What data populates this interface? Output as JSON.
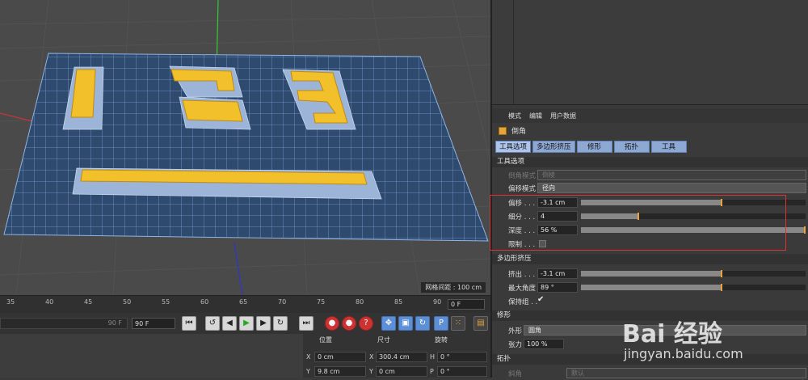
{
  "viewport": {
    "grid_spacing_label": "网格间距 : 100 cm"
  },
  "timeline": {
    "ticks": [
      "35",
      "40",
      "45",
      "50",
      "55",
      "60",
      "65",
      "70",
      "75",
      "80",
      "85",
      "90"
    ],
    "end_frame": "0 F"
  },
  "transport": {
    "slider_value": "90 F",
    "frame_field": "90 F"
  },
  "coordinates": {
    "headers": {
      "position": "位置",
      "size": "尺寸",
      "rotation": "旋转"
    },
    "rows": [
      {
        "axis": "X",
        "pos": "0 cm",
        "size_axis": "X",
        "size": "300.4 cm",
        "rot_axis": "H",
        "rot": "0 °"
      },
      {
        "axis": "Y",
        "pos": "9.8 cm",
        "size_axis": "Y",
        "size": "0 cm",
        "rot_axis": "P",
        "rot": "0 °"
      }
    ]
  },
  "panel": {
    "menu": [
      "模式",
      "编辑",
      "用户数据"
    ],
    "object_name": "倒角",
    "tabs": [
      "工具选项",
      "多边形挤压",
      "修形",
      "拓扑",
      "工具"
    ],
    "tool_options": {
      "section": "工具选项",
      "bevel_mode_label": "倒角模式",
      "bevel_mode_value": "倒棱",
      "offset_mode_label": "偏移模式",
      "offset_mode_value": "径向",
      "offset_label": "偏移 . . .",
      "offset_value": "-3.1 cm",
      "offset_fraction": 0.63,
      "subdiv_label": "细分 . . .",
      "subdiv_value": "4",
      "subdiv_fraction": 0.26,
      "depth_label": "深度 . . .",
      "depth_value": "56 %",
      "depth_fraction": 1.0,
      "limit_label": "限制 . . ."
    },
    "extrude": {
      "section": "多边形挤压",
      "extrude_label": "挤出 . . .",
      "extrude_value": "-3.1 cm",
      "extrude_fraction": 0.63,
      "max_angle_label": "最大角度",
      "max_angle_value": "89 °",
      "max_angle_fraction": 0.63,
      "keep_groups_label": "保持组 . ."
    },
    "shaping": {
      "section": "修形",
      "shape_label": "外形",
      "shape_value": "圆角",
      "tension_label": "张力",
      "tension_value": "100 %"
    },
    "topology": {
      "section": "拓扑",
      "mitering_label": "斜角",
      "mitering_value": "默认"
    }
  },
  "watermark": {
    "text": "Bai 经验",
    "url": "jingyan.baidu.com"
  },
  "colors": {
    "accent_orange": "#e8a33a",
    "selection_yellow": "#f2c02a",
    "mesh_blue": "#3b5f8a",
    "highlight_red": "#dd3333"
  }
}
